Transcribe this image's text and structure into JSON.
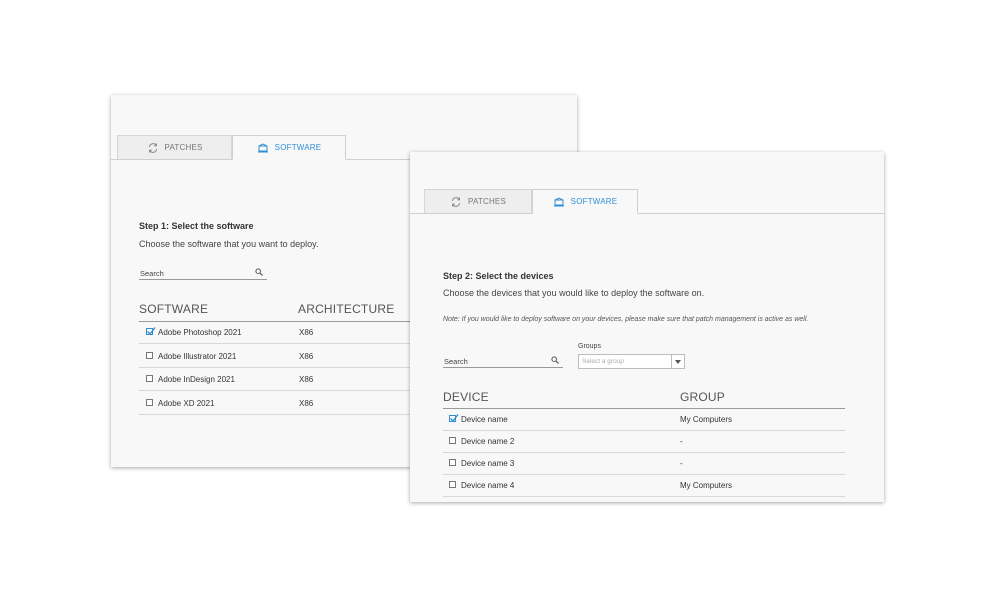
{
  "panel1": {
    "tabs": {
      "patches": "PATCHES",
      "software": "SOFTWARE"
    },
    "step_title": "Step 1:  Select the software",
    "step_desc": "Choose the software that you want to deploy.",
    "search_placeholder": "Search",
    "columns": {
      "software": "SOFTWARE",
      "architecture": "ARCHITECTURE"
    },
    "rows": [
      {
        "name": "Adobe Photoshop 2021",
        "arch": "X86",
        "checked": true
      },
      {
        "name": "Adobe Illustrator 2021",
        "arch": "X86",
        "checked": false
      },
      {
        "name": "Adobe InDesign 2021",
        "arch": "X86",
        "checked": false
      },
      {
        "name": "Adobe XD 2021",
        "arch": "X86",
        "checked": false
      }
    ]
  },
  "panel2": {
    "tabs": {
      "patches": "PATCHES",
      "software": "SOFTWARE"
    },
    "step_title": "Step 2: Select the  devices",
    "step_desc": "Choose the devices that you would like to deploy the software on.",
    "note": "Note: If you would like to deploy software on your devices, please make sure that patch management is active as well.",
    "search_placeholder": "Search",
    "groups_label": "Groups",
    "group_select_placeholder": "Select a group",
    "columns": {
      "device": "DEVICE",
      "group": "GROUP"
    },
    "rows": [
      {
        "name": "Device name",
        "group": "My Computers",
        "checked": true
      },
      {
        "name": "Device name 2",
        "group": "-",
        "checked": false
      },
      {
        "name": "Device name 3",
        "group": "-",
        "checked": false
      },
      {
        "name": "Device name 4",
        "group": "My Computers",
        "checked": false
      }
    ]
  },
  "icons": {
    "patches": "refresh-icon",
    "software": "software-package-icon",
    "search": "search-icon",
    "caret": "chevron-down-icon",
    "check": "checkmark-icon"
  },
  "colors": {
    "accent": "#2d8fd5",
    "panel_bg": "#f8f8f8",
    "text": "#333333"
  }
}
